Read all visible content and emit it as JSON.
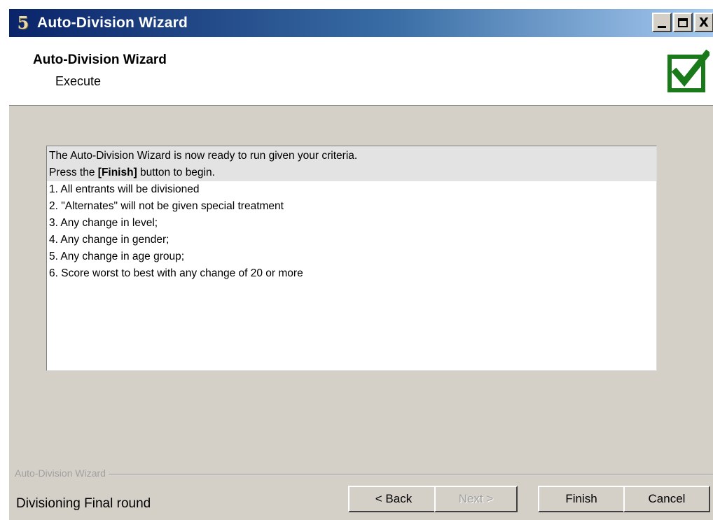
{
  "window": {
    "title": "Auto-Division Wizard",
    "icon_glyph": "5",
    "controls": {
      "minimize": "_",
      "maximize": "□",
      "close": "X"
    }
  },
  "header": {
    "title": "Auto-Division Wizard",
    "subtitle": "Execute",
    "icon": "check-box-icon",
    "icon_color": "#1a7a1a"
  },
  "panel": {
    "intro": {
      "line1": "The Auto-Division Wizard is now ready to run given your criteria.",
      "line2_prefix": "Press the ",
      "line2_bold": "[Finish]",
      "line2_suffix": " button to begin."
    },
    "items": [
      "1. All entrants will be divisioned",
      "2. \"Alternates\" will not be given special treatment",
      "3. Any change in level;",
      "4. Any change in gender;",
      "5. Any change in age group;",
      "6. Score worst to best with any change of 20 or more"
    ]
  },
  "footer": {
    "group_label": "Auto-Division Wizard",
    "status": "Divisioning Final round",
    "buttons": {
      "back": "< Back",
      "next": "Next >",
      "finish": "Finish",
      "cancel": "Cancel"
    }
  }
}
